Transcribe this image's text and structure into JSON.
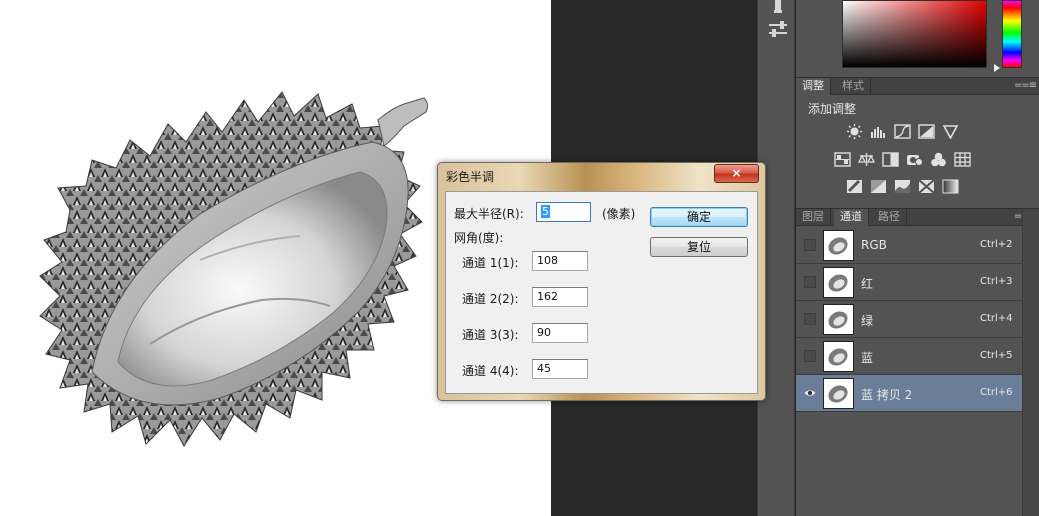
{
  "panels": {
    "adjust_tabs": [
      {
        "label": "调整",
        "active": true
      },
      {
        "label": "样式",
        "active": false
      }
    ],
    "adjust_heading": "添加调整",
    "adjust_icons": [
      [
        "brightness-contrast-icon",
        "levels-icon",
        "curves-icon",
        "exposure-icon",
        "vibrance-triangle-icon"
      ],
      [
        "hue-saturation-icon",
        "color-balance-icon",
        "black-white-icon",
        "photo-filter-icon",
        "channel-mixer-icon",
        "color-lookup-icon"
      ],
      [
        "invert-icon",
        "posterize-icon",
        "threshold-icon",
        "selective-color-icon",
        "gradient-map-icon"
      ]
    ],
    "channel_tabs": [
      {
        "label": "图层",
        "active": false
      },
      {
        "label": "通道",
        "active": true
      },
      {
        "label": "路径",
        "active": false
      }
    ],
    "channels": [
      {
        "name": "RGB",
        "shortcut": "Ctrl+2",
        "visible": false,
        "selected": false
      },
      {
        "name": "红",
        "shortcut": "Ctrl+3",
        "visible": false,
        "selected": false
      },
      {
        "name": "绿",
        "shortcut": "Ctrl+4",
        "visible": false,
        "selected": false
      },
      {
        "name": "蓝",
        "shortcut": "Ctrl+5",
        "visible": false,
        "selected": false
      },
      {
        "name": "蓝 拷贝 2",
        "shortcut": "Ctrl+6",
        "visible": true,
        "selected": true
      }
    ]
  },
  "dialog": {
    "title": "彩色半调",
    "close_label": "×",
    "max_radius_label": "最大半径(R):",
    "max_radius_value": "5",
    "max_radius_unit": "(像素)",
    "screen_angle_label": "网角(度):",
    "channels": [
      {
        "label": "通道 1(1):",
        "value": "108"
      },
      {
        "label": "通道 2(2):",
        "value": "162"
      },
      {
        "label": "通道 3(3):",
        "value": "90"
      },
      {
        "label": "通道 4(4):",
        "value": "45"
      }
    ],
    "ok_label": "确定",
    "reset_label": "复位"
  },
  "colors": {
    "foreground_hue": "#e30000",
    "selected_row": "#6b7e99",
    "panel_bg": "#535353"
  }
}
